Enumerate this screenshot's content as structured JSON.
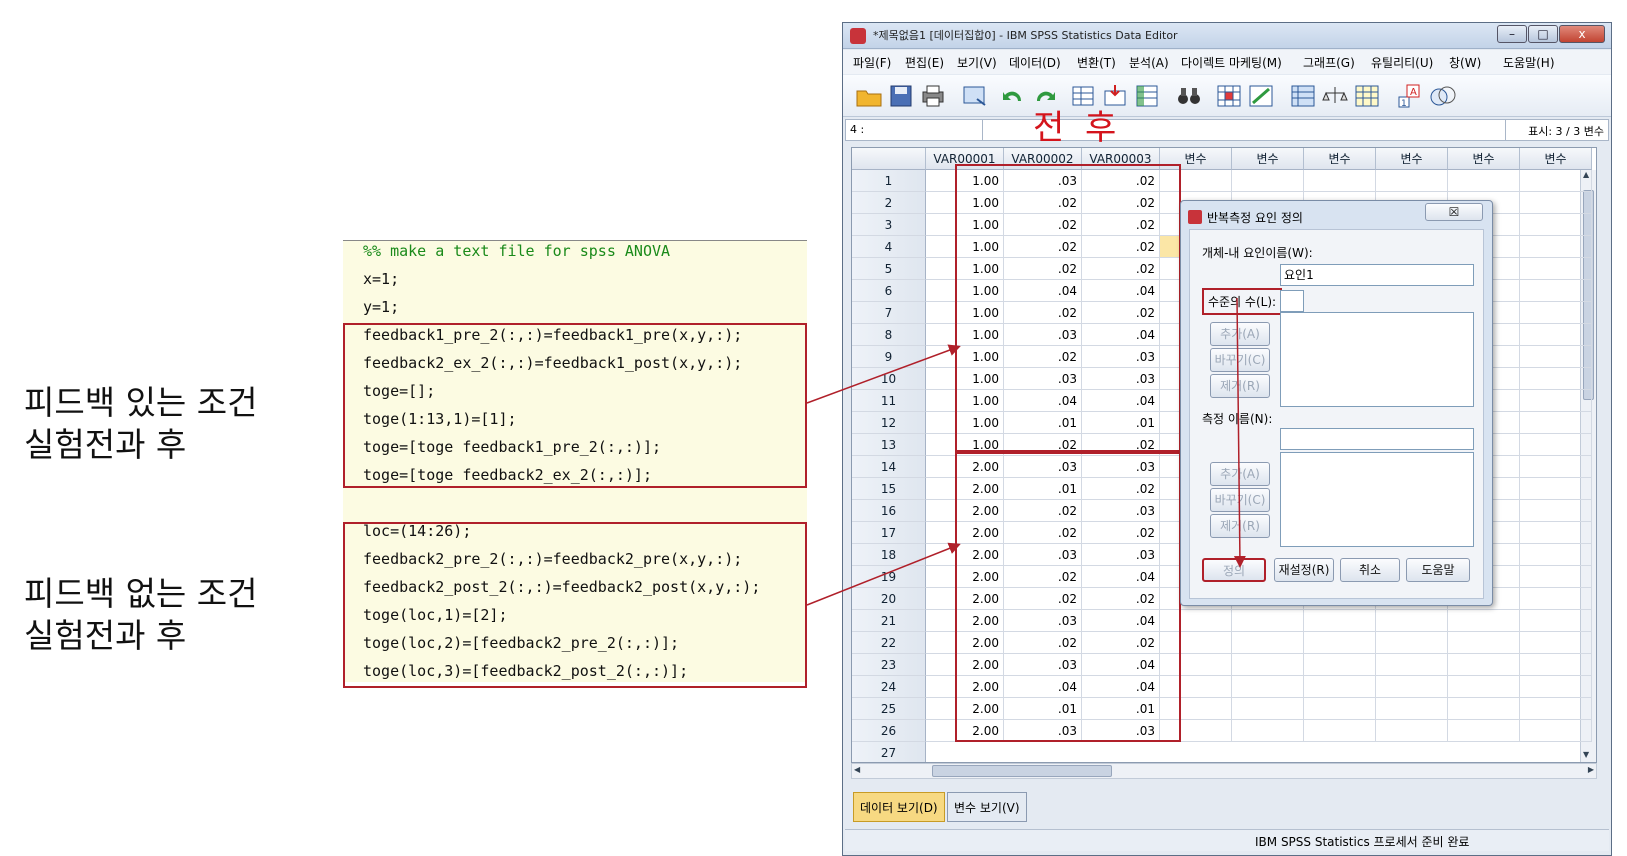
{
  "labels": {
    "feedback": [
      "피드백 있는 조건",
      "실험전과 후"
    ],
    "no_feedback": [
      "피드백 없는 조건",
      "실험전과 후"
    ],
    "pre": "전",
    "post": "후"
  },
  "code": {
    "comment": "%% make a text file for spss ANOVA",
    "lines": [
      "x=1;",
      "y=1;",
      "feedback1_pre_2(:,:)=feedback1_pre(x,y,:);",
      "feedback2_ex_2(:,:)=feedback1_post(x,y,:);",
      "toge=[];",
      "toge(1:13,1)=[1];",
      "toge=[toge feedback1_pre_2(:,:)];",
      "toge=[toge feedback2_ex_2(:,:)];",
      "",
      "loc=(14:26);",
      "feedback2_pre_2(:,:)=feedback2_pre(x,y,:);",
      "feedback2_post_2(:,:)=feedback2_post(x,y,:);",
      "toge(loc,1)=[2];",
      "toge(loc,2)=[feedback2_pre_2(:,:)];",
      "toge(loc,3)=[feedback2_post_2(:,:)];"
    ]
  },
  "window": {
    "title": "*제목없음1 [데이터집합0] - IBM SPSS Statistics Data Editor",
    "minimize": "–",
    "maximize": "□",
    "close": "x"
  },
  "menu": [
    "파일(F)",
    "편집(E)",
    "보기(V)",
    "데이터(D)",
    "변환(T)",
    "분석(A)",
    "다이렉트 마케팅(M)",
    "그래프(G)",
    "유틸리티(U)",
    "창(W)",
    "도움말(H)"
  ],
  "cellbar": {
    "cell_ref": "4 :",
    "visible": "표시: 3 / 3 변수"
  },
  "grid": {
    "columns": [
      "VAR00001",
      "VAR00002",
      "VAR00003",
      "변수",
      "변수",
      "변수",
      "변수",
      "변수",
      "변수"
    ],
    "rows": [
      [
        "1.00",
        ".03",
        ".02"
      ],
      [
        "1.00",
        ".02",
        ".02"
      ],
      [
        "1.00",
        ".02",
        ".02"
      ],
      [
        "1.00",
        ".02",
        ".02"
      ],
      [
        "1.00",
        ".02",
        ".02"
      ],
      [
        "1.00",
        ".04",
        ".04"
      ],
      [
        "1.00",
        ".02",
        ".02"
      ],
      [
        "1.00",
        ".03",
        ".04"
      ],
      [
        "1.00",
        ".02",
        ".03"
      ],
      [
        "1.00",
        ".03",
        ".03"
      ],
      [
        "1.00",
        ".04",
        ".04"
      ],
      [
        "1.00",
        ".01",
        ".01"
      ],
      [
        "1.00",
        ".02",
        ".02"
      ],
      [
        "2.00",
        ".03",
        ".03"
      ],
      [
        "2.00",
        ".01",
        ".02"
      ],
      [
        "2.00",
        ".02",
        ".03"
      ],
      [
        "2.00",
        ".02",
        ".02"
      ],
      [
        "2.00",
        ".03",
        ".03"
      ],
      [
        "2.00",
        ".02",
        ".04"
      ],
      [
        "2.00",
        ".02",
        ".02"
      ],
      [
        "2.00",
        ".03",
        ".04"
      ],
      [
        "2.00",
        ".02",
        ".02"
      ],
      [
        "2.00",
        ".03",
        ".04"
      ],
      [
        "2.00",
        ".04",
        ".04"
      ],
      [
        "2.00",
        ".01",
        ".01"
      ],
      [
        "2.00",
        ".03",
        ".03"
      ]
    ],
    "last_row_label": "27"
  },
  "dialog": {
    "title": "반복측정 요인 정의",
    "close": "☒",
    "factor_label": "개체-내 요인이름(W):",
    "factor_value": "요인1",
    "levels_label": "수준의 수(L):",
    "levels_value": "",
    "measure_label": "측정 이름(N):",
    "measure_value": "",
    "add": "추가(A)",
    "change": "바꾸기(C)",
    "remove": "제거(R)",
    "define": "정의",
    "reset": "재설정(R)",
    "cancel": "취소",
    "help": "도움말"
  },
  "tabs": {
    "data_view": "데이터 보기(D)",
    "variable_view": "변수 보기(V)"
  },
  "status": {
    "processor": "IBM SPSS Statistics 프로세서 준비 완료"
  }
}
